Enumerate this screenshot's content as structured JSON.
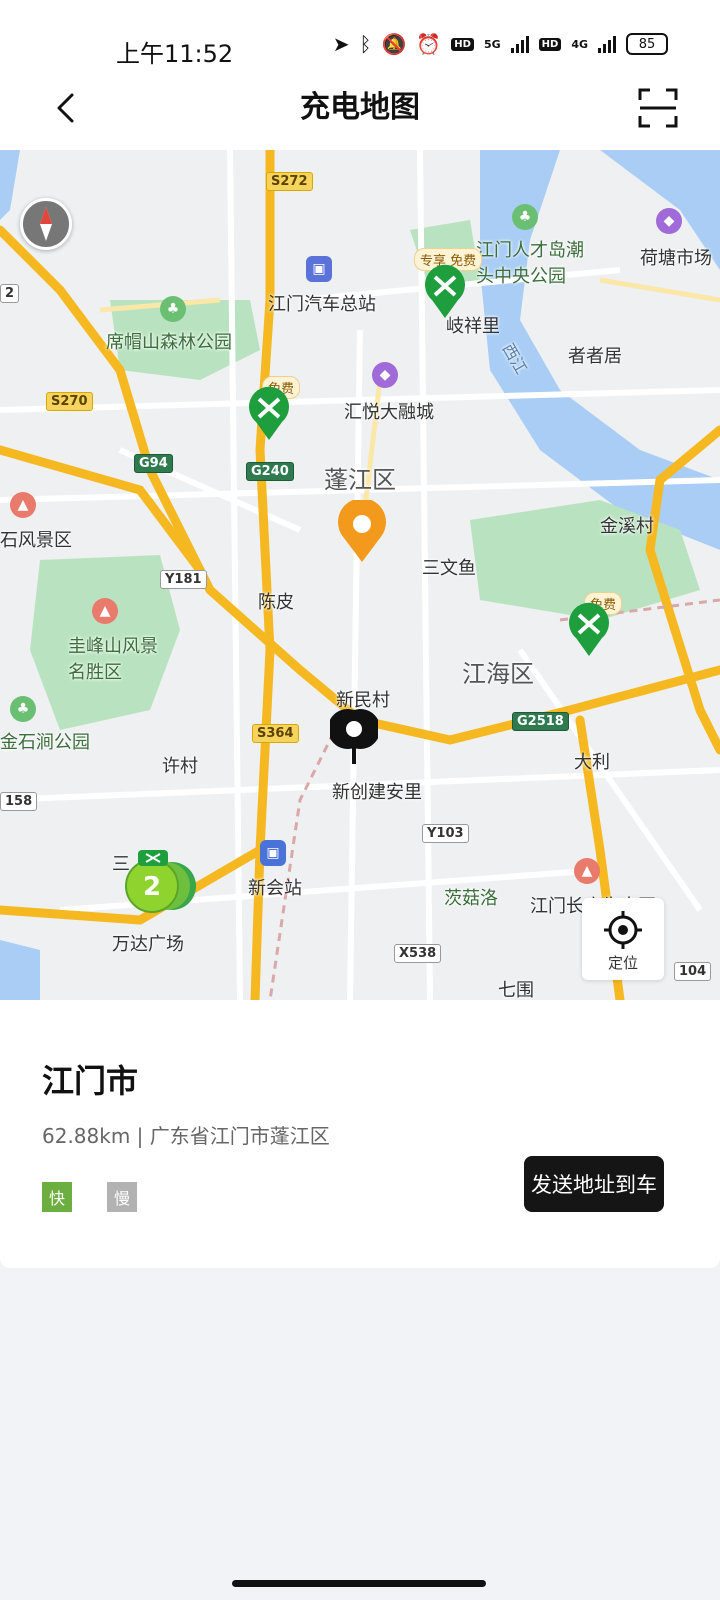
{
  "status_bar": {
    "time": "上午11:52",
    "network1": "5G",
    "network2": "4G",
    "hd": "HD",
    "battery": "85"
  },
  "header": {
    "title": "充电地图"
  },
  "map": {
    "district_labels": [
      "蓬江区",
      "江海区"
    ],
    "poi_labels": {
      "jiangmen_bus": "江门汽车总站",
      "ximao_park": "席帽山森林公园",
      "huiyue": "汇悦大融城",
      "rencai_island": "江门人才岛潮头中央公园",
      "qixiangli": "岐祥里",
      "hetang": "荷塘市场",
      "zhezhe": "者者居",
      "jinxi": "金溪村",
      "sanwenyu": "三文鱼",
      "chenpi": "陈皮",
      "guifeng": "圭峰山风景名胜区",
      "shifeng": "石风景区",
      "xinmin": "新民村",
      "xinchuang": "新创建安里",
      "xucun": "许村",
      "xinhui_station": "新会站",
      "wanda": "万达广场",
      "cigulu": "茨菇洛",
      "jiangmen_changguang": "江门长广生态园",
      "dali": "大利",
      "qiwei": "七围",
      "shijian_park": "金石涧公园",
      "xijiang": "西江",
      "san": "三"
    },
    "road_shields": [
      "S272",
      "S270",
      "G94",
      "G240",
      "Y181",
      "S364",
      "G2518",
      "Y103",
      "X538",
      "104",
      "158",
      "2"
    ],
    "charger_tags": [
      "专享 免费",
      "免费",
      "免费"
    ],
    "cluster_count": "2",
    "locate_label": "定位"
  },
  "card": {
    "title": "江门市",
    "subtitle": "62.88km | 广东省江门市蓬江区",
    "fast_label": "快",
    "slow_label": "慢",
    "send_button": "发送地址到车"
  },
  "colors": {
    "map_bg": "#eef0f2",
    "water": "#a9cdf5",
    "green_area": "#b9e3c0",
    "expressway": "#f6b821",
    "road": "#ffffff",
    "charger_green": "#1f9e3e",
    "accent_orange": "#f39a1d",
    "fast_badge": "#6cae3f",
    "slow_badge": "#b2b2b2",
    "button": "#151515"
  },
  "icons": {
    "back": "chevron-left-icon",
    "scan": "scan-frame-icon",
    "compass": "compass-icon",
    "locate": "crosshair-icon",
    "charger": "charging-station-icon"
  }
}
